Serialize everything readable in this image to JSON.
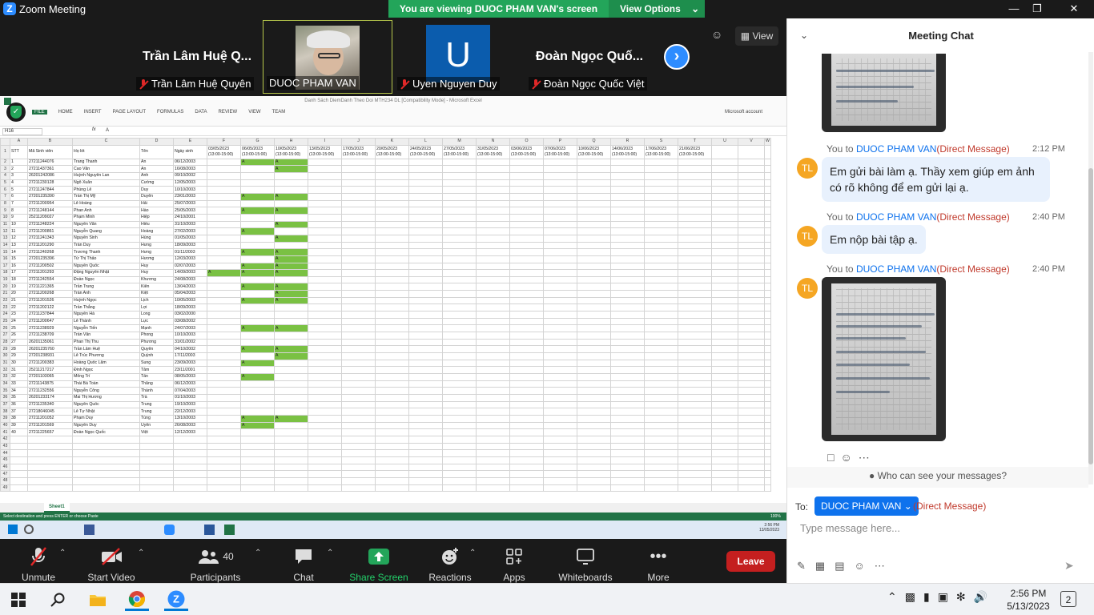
{
  "window": {
    "app_title": "Zoom Meeting",
    "banner_text": "You are viewing DUOC PHAM VAN's screen",
    "view_options": "View Options"
  },
  "top_controls": {
    "view_label": "View"
  },
  "participants": [
    {
      "big_name": "Trần Lâm Huệ Q...",
      "label": "Trần Lâm Huệ Quyên",
      "muted": true
    },
    {
      "big_name": "",
      "label": "DUOC PHAM VAN",
      "muted": false
    },
    {
      "big_name": "U",
      "label": "Uyen Nguyen Duy",
      "muted": true
    },
    {
      "big_name": "Đoàn Ngọc Quố...",
      "label": "Đoàn Ngọc Quốc Việt",
      "muted": true
    }
  ],
  "excel": {
    "window_title": "Danh Sách DiemDanh Theo Doi MTH234 DL  [Compatibility Mode] - Microsoft Excel",
    "ribbon_tabs": [
      "FILE",
      "HOME",
      "INSERT",
      "PAGE LAYOUT",
      "FORMULAS",
      "DATA",
      "REVIEW",
      "VIEW",
      "TEAM"
    ],
    "account": "Microsoft account",
    "name_box": "H16",
    "formula": "A",
    "col_letters": [
      "A",
      "B",
      "C",
      "D",
      "E",
      "F",
      "G",
      "H",
      "I",
      "J",
      "K",
      "L",
      "M",
      "N",
      "O",
      "P",
      "Q",
      "R",
      "S",
      "T",
      "U",
      "V",
      "W"
    ],
    "headers": [
      "STT",
      "Mã Sinh viên",
      "Họ lót",
      "Tên",
      "Ngày sinh"
    ],
    "dates": [
      "03/05/2023",
      "06/05/2023",
      "10/05/2023",
      "13/05/2023",
      "17/05/2023",
      "20/05/2023",
      "24/05/2023",
      "27/05/2023",
      "31/05/2023",
      "03/06/2023",
      "07/06/2023",
      "10/06/2023",
      "14/06/2023",
      "17/06/2023",
      "21/06/2023"
    ],
    "time_slot": "(13:00-15:00)",
    "rows": [
      [
        "1",
        "27211244076",
        "Trang Thanh",
        "An",
        "06/12/2003",
        "",
        "A",
        "A"
      ],
      [
        "2",
        "27211437361",
        "Cao Văn",
        "An",
        "16/08/2003",
        "",
        "",
        "A"
      ],
      [
        "3",
        "26201242086",
        "Huỳnh Nguyễn Lan",
        "Anh",
        "09/10/2002",
        "",
        "",
        ""
      ],
      [
        "4",
        "27211230128",
        "Ngô Xuân",
        "Cường",
        "12/05/2003",
        "",
        "",
        ""
      ],
      [
        "5",
        "27211247844",
        "Phùng Lê",
        "Duy",
        "10/10/2003",
        "",
        "",
        ""
      ],
      [
        "6",
        "27201235390",
        "Trần Thị Mỹ",
        "Duyên",
        "23/01/2003",
        "",
        "A",
        "A"
      ],
      [
        "7",
        "27211200954",
        "Lê Hoàng",
        "Hải",
        "25/07/2003",
        "",
        "",
        ""
      ],
      [
        "8",
        "27211248144",
        "Phan Anh",
        "Hào",
        "25/05/2003",
        "",
        "A",
        "A"
      ],
      [
        "9",
        "25211209027",
        "Phạm Minh",
        "Hiệp",
        "24/10/2001",
        "",
        "",
        ""
      ],
      [
        "10",
        "27211248224",
        "Nguyễn Văn",
        "Hiếu",
        "31/10/2003",
        "",
        "",
        "A"
      ],
      [
        "11",
        "27211200861",
        "Nguyễn Quang",
        "Hoàng",
        "27/02/2003",
        "",
        "A",
        ""
      ],
      [
        "12",
        "27211241343",
        "Nguyễn Sinh",
        "Hùng",
        "01/05/2003",
        "",
        "",
        "A"
      ],
      [
        "13",
        "27211201290",
        "Trần Duy",
        "Hưng",
        "18/09/2003",
        "",
        "",
        ""
      ],
      [
        "14",
        "27211240268",
        "Trương Thanh",
        "Hưng",
        "01/11/2003",
        "",
        "A",
        "A"
      ],
      [
        "15",
        "27201235396",
        "Từ Thị Thảo",
        "Hương",
        "12/03/2003",
        "",
        "",
        "A"
      ],
      [
        "16",
        "27211200502",
        "Nguyễn Quốc",
        "Huy",
        "02/07/2003",
        "",
        "A",
        "A"
      ],
      [
        "17",
        "27211201293",
        "Đặng Nguyễn Nhật",
        "Huy",
        "14/09/2003",
        "A",
        "A",
        "A"
      ],
      [
        "18",
        "27211242554",
        "Đoàn Ngọc",
        "Khương",
        "24/08/2003",
        "",
        "",
        ""
      ],
      [
        "19",
        "27211221365",
        "Trần Trung",
        "Kiên",
        "13/04/2003",
        "",
        "A",
        "A"
      ],
      [
        "20",
        "27211200268",
        "Trần Anh",
        "Kiệt",
        "05/04/2003",
        "",
        "",
        "A"
      ],
      [
        "21",
        "27211201526",
        "Huỳnh Ngọc",
        "Lịch",
        "10/05/2003",
        "",
        "A",
        "A"
      ],
      [
        "22",
        "27211202122",
        "Trần Thắng",
        "Lợi",
        "18/09/2003",
        "",
        "",
        ""
      ],
      [
        "23",
        "27211237844",
        "Nguyễn Hà",
        "Long",
        "03/02/2000",
        "",
        "",
        ""
      ],
      [
        "24",
        "27211200647",
        "Lê Thành",
        "Lực",
        "03/08/2002",
        "",
        "",
        ""
      ],
      [
        "25",
        "27211238929",
        "Nguyễn Tiến",
        "Mạnh",
        "24/07/2003",
        "",
        "A",
        "A"
      ],
      [
        "26",
        "27211238709",
        "Trần Văn",
        "Phong",
        "10/10/2003",
        "",
        "",
        ""
      ],
      [
        "27",
        "26201135061",
        "Phan Thị Thu",
        "Phương",
        "31/01/2002",
        "",
        "",
        ""
      ],
      [
        "28",
        "26201235760",
        "Trần Lâm Huệ",
        "Quyên",
        "04/10/2002",
        "",
        "A",
        "A"
      ],
      [
        "29",
        "27201238931",
        "Lê Trúc Phương",
        "Quỳnh",
        "17/11/2003",
        "",
        "",
        "A"
      ],
      [
        "30",
        "27211200383",
        "Hoàng Quốc Lâm",
        "Sung",
        "23/09/2003",
        "",
        "A",
        ""
      ],
      [
        "31",
        "25211217217",
        "Đinh Ngọc",
        "Tâm",
        "23/11/2001",
        "",
        "",
        ""
      ],
      [
        "32",
        "27201103065",
        "Mông Trí",
        "Tấn",
        "08/05/2003",
        "",
        "A",
        ""
      ],
      [
        "33",
        "27211143875",
        "Thái Bá Toàn",
        "Thắng",
        "06/12/2003",
        "",
        "",
        ""
      ],
      [
        "34",
        "27211232556",
        "Nguyễn Công",
        "Thành",
        "07/04/2003",
        "",
        "",
        ""
      ],
      [
        "35",
        "26201233174",
        "Mai Thị Hương",
        "Trà",
        "01/10/2003",
        "",
        "",
        ""
      ],
      [
        "36",
        "27211235340",
        "Nguyễn Quốc",
        "Trung",
        "19/10/2003",
        "",
        "",
        ""
      ],
      [
        "37",
        "27218046045",
        "Lê Tự Nhật",
        "Trung",
        "22/12/2003",
        "",
        "",
        ""
      ],
      [
        "38",
        "27211201052",
        "Phạm Duy",
        "Tùng",
        "13/10/2003",
        "",
        "A",
        "A"
      ],
      [
        "39",
        "27211201569",
        "Nguyễn Duy",
        "Uyên",
        "26/08/2003",
        "",
        "A",
        ""
      ],
      [
        "40",
        "27211225657",
        "Đoàn Ngọc Quốc",
        "Việt",
        "12/12/2003",
        "",
        "",
        ""
      ]
    ],
    "sheet_tab": "Sheet1",
    "status_text": "Select destination and press ENTER or choose Paste",
    "zoom": "100%",
    "taskbar_time": "2:56 PM",
    "taskbar_date": "13/05/2023"
  },
  "chat": {
    "title": "Meeting Chat",
    "messages": [
      {
        "from_prefix": "You to",
        "to": "DUOC PHAM VAN",
        "dm": "(Direct Message)",
        "time": "2:12 PM",
        "avatar": "TL",
        "text": "Em gửi bài làm ạ. Thầy xem giúp em ảnh có rõ không để em gửi lại ạ."
      },
      {
        "from_prefix": "You to",
        "to": "DUOC PHAM VAN",
        "dm": "(Direct Message)",
        "time": "2:40 PM",
        "avatar": "TL",
        "text": "Em nộp bài tập ạ."
      },
      {
        "from_prefix": "You to",
        "to": "DUOC PHAM VAN",
        "dm": "(Direct Message)",
        "time": "2:40 PM",
        "avatar": "TL",
        "text": ""
      }
    ],
    "who_can_see": "Who can see your messages?",
    "to_label": "To:",
    "recipient": "DUOC PHAM VAN",
    "recipient_dm": "(Direct Message)",
    "input_placeholder": "Type message here..."
  },
  "toolbar": {
    "unmute": "Unmute",
    "start_video": "Start Video",
    "participants": "Participants",
    "participants_count": "40",
    "chat": "Chat",
    "share_screen": "Share Screen",
    "reactions": "Reactions",
    "apps": "Apps",
    "whiteboards": "Whiteboards",
    "more": "More",
    "leave": "Leave"
  },
  "taskbar": {
    "time": "2:56 PM",
    "date": "5/13/2023",
    "notifications": "2"
  },
  "colors": {
    "zoom_blue": "#2d8cff",
    "banner_green": "#23a55a",
    "leave_red": "#c41f1f",
    "attendance_green": "#7ac143",
    "avatar_orange": "#f5a623",
    "excel_green": "#217346"
  }
}
